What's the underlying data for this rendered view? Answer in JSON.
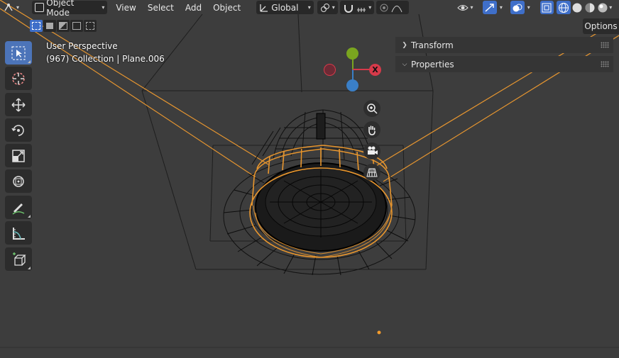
{
  "header": {
    "mode_label": "Object Mode",
    "menus": [
      "View",
      "Select",
      "Add",
      "Object"
    ],
    "transform_orientation": "Global"
  },
  "viewport": {
    "perspective_label": "User Perspective",
    "collection_label": "(967) Collection | Plane.006"
  },
  "side_panel": {
    "options_label": "Options",
    "transform_label": "Transform",
    "properties_label": "Properties"
  },
  "gizmo": {
    "x_label": "X",
    "colors": {
      "x": "#d63a4a",
      "y": "#7aa51f",
      "z": "#3a7fc7",
      "x_neg": "#9b3040"
    }
  },
  "colors": {
    "viewport_bg": "#3d3d3d",
    "selection": "#ff9e2c",
    "wire": "#000000",
    "active_tool": "#4c74b9"
  }
}
